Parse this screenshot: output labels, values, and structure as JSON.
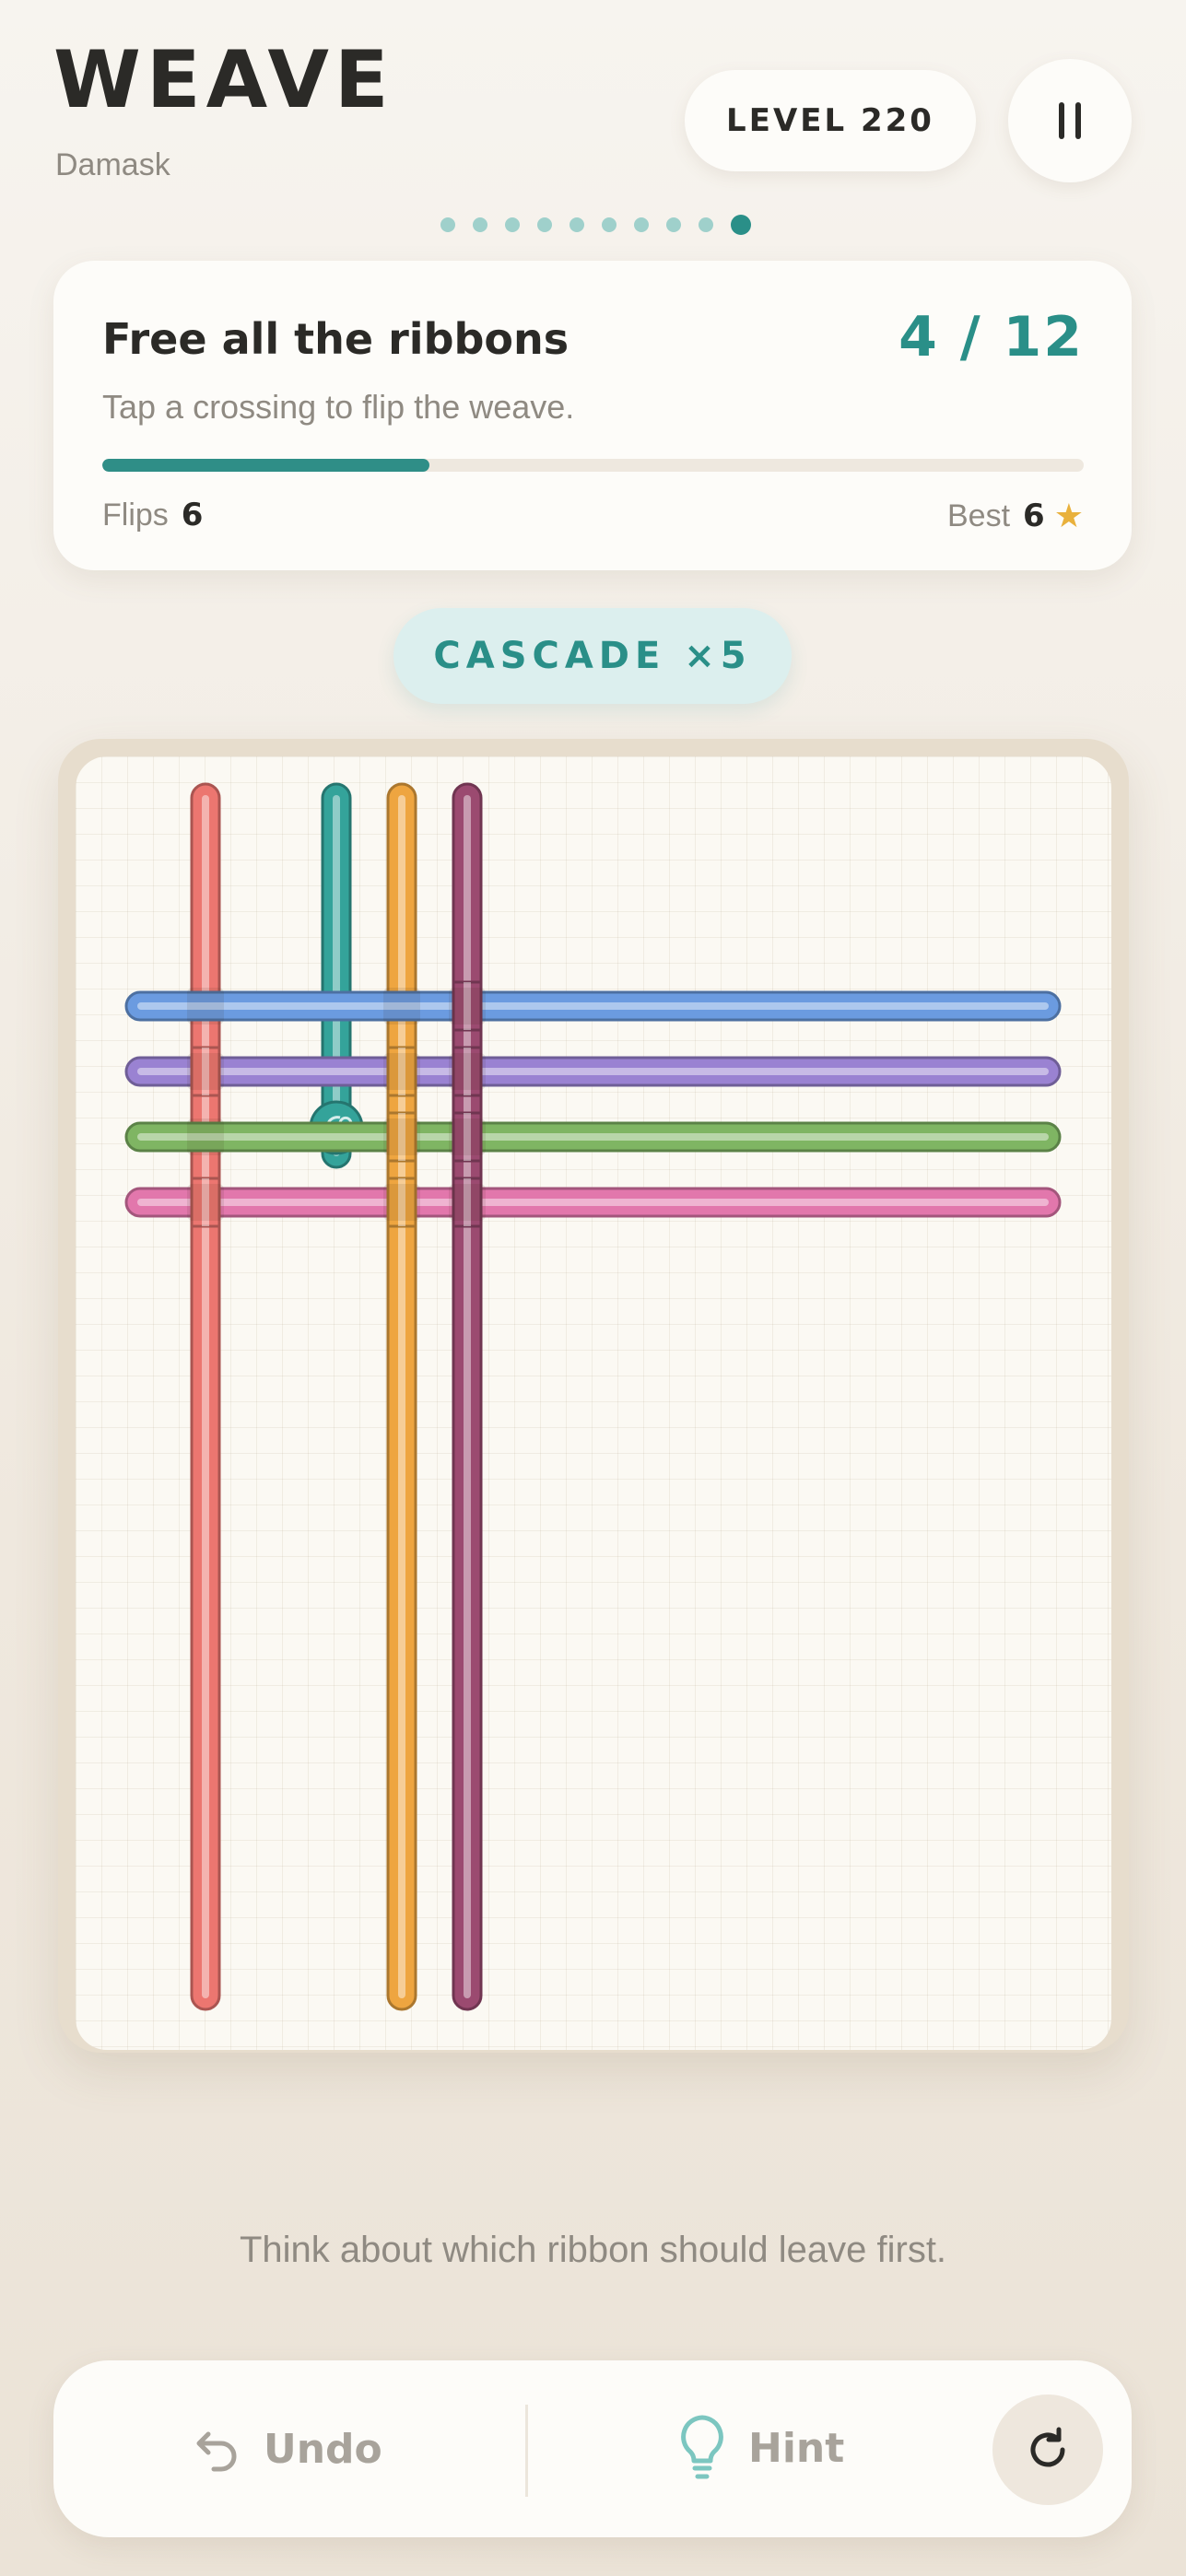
{
  "header": {
    "title": "WEAVE",
    "subtitle": "Damask",
    "level_label": "LEVEL 220",
    "pause_icon": "pause-icon"
  },
  "page_indicator": {
    "total": 10,
    "active_index": 9
  },
  "goal_card": {
    "title": "Free all the ribbons",
    "count": "4 / 12",
    "instruction": "Tap a crossing to flip the weave.",
    "progress_fraction": 0.333,
    "flips_label": "Flips",
    "flips_value": "6",
    "best_label": "Best",
    "best_value": "6",
    "best_icon": "star-icon"
  },
  "combo": {
    "label": "CASCADE ×5"
  },
  "board": {
    "vertical_ribbons": [
      {
        "name": "coral",
        "color": "#ec7670",
        "col": 2
      },
      {
        "name": "teal",
        "color": "#34a39a",
        "col": 4,
        "freed": true
      },
      {
        "name": "orange",
        "color": "#eea540",
        "col": 5
      },
      {
        "name": "plum",
        "color": "#9b4a70",
        "col": 6
      }
    ],
    "horizontal_ribbons": [
      {
        "name": "blue",
        "color": "#6b9be0",
        "row": 4
      },
      {
        "name": "purple",
        "color": "#9a82d2",
        "row": 5
      },
      {
        "name": "green",
        "color": "#7fb563",
        "row": 6
      },
      {
        "name": "pink",
        "color": "#e277ac",
        "row": 7
      }
    ]
  },
  "hint_message": "Think about which ribbon should leave first.",
  "toolbar": {
    "undo_label": "Undo",
    "undo_icon": "undo-arrow-icon",
    "hint_label": "Hint",
    "hint_icon": "lightbulb-icon",
    "restart_icon": "restart-icon"
  }
}
